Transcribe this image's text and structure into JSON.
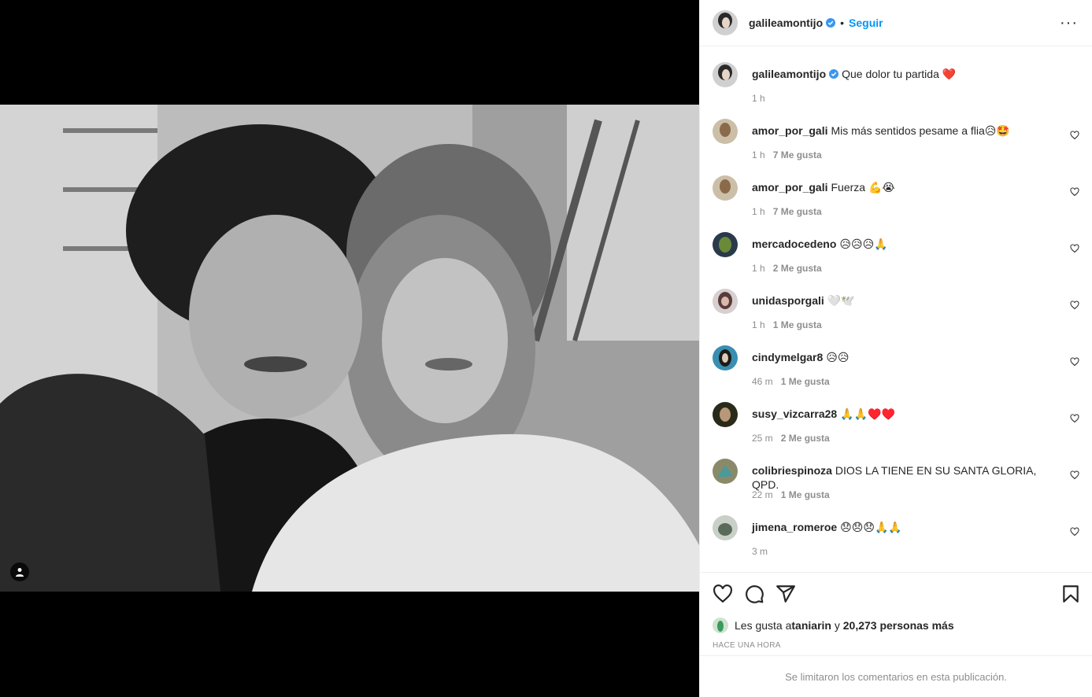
{
  "post": {
    "username": "galileamontijo",
    "follow_label": "Seguir",
    "more_label": "···",
    "caption": "Que dolor tu partida ❤️",
    "caption_time": "1 h"
  },
  "comments": [
    {
      "user": "amor_por_gali",
      "text": "Mis más sentidos pesame a flia😥🤩",
      "time": "1 h",
      "likes": "7 Me gusta"
    },
    {
      "user": "amor_por_gali",
      "text": "Fuerza 💪😭",
      "time": "1 h",
      "likes": "7 Me gusta"
    },
    {
      "user": "mercadocedeno",
      "text": "😥😥😥🙏",
      "time": "1 h",
      "likes": "2 Me gusta"
    },
    {
      "user": "unidasporgali",
      "text": "🤍🕊️",
      "time": "1 h",
      "likes": "1 Me gusta"
    },
    {
      "user": "cindymelgar8",
      "text": "😥😥",
      "time": "46 m",
      "likes": "1 Me gusta"
    },
    {
      "user": "susy_vizcarra28",
      "text": "🙏🙏♥️♥️",
      "time": "25 m",
      "likes": "2 Me gusta"
    },
    {
      "user": "colibriespinoza",
      "text": "DIOS LA TIENE EN SU SANTA GLORIA, QPD.",
      "time": "22 m",
      "likes": "1 Me gusta"
    },
    {
      "user": "jimena_romeroe",
      "text": "😞😞😞🙏🙏",
      "time": "3 m",
      "likes": ""
    }
  ],
  "likes_line": {
    "prefix": "Les gusta a ",
    "user": "taniarin",
    "middle": " y ",
    "others": "20,273 personas más"
  },
  "timestamp": "HACE UNA HORA",
  "comments_limited": "Se limitaron los comentarios en esta publicación.",
  "colors": {
    "accent": "#0095f6",
    "like_red": "#ed4956",
    "text": "#262626",
    "muted": "#8e8e8e",
    "border": "#efefef"
  },
  "icons": [
    "verified-badge-icon",
    "more-options-icon",
    "heart-icon",
    "comment-icon",
    "share-icon",
    "save-icon",
    "user-tag-icon"
  ]
}
